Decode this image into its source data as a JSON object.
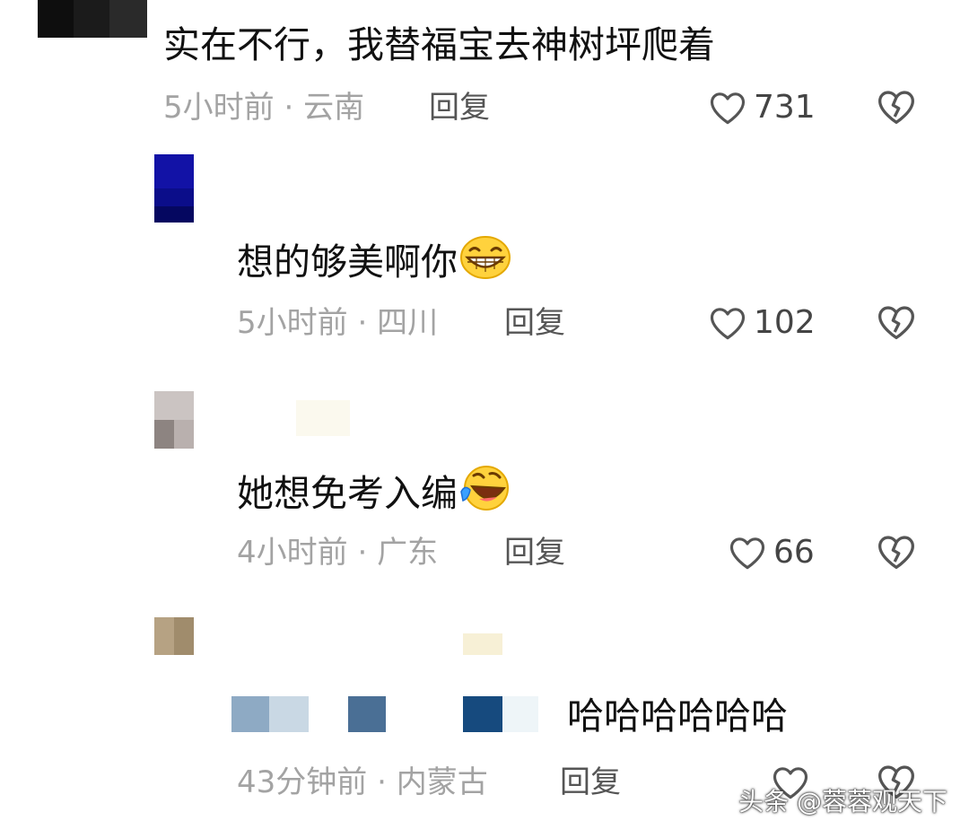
{
  "comments": [
    {
      "text": "实在不行，我替福宝去神树坪爬着",
      "time": "5小时前",
      "location": "云南",
      "reply_label": "回复",
      "likes": "731"
    },
    {
      "text": "想的够美啊你",
      "emoji": "grinning-face-emoji",
      "time": "5小时前",
      "location": "四川",
      "reply_label": "回复",
      "likes": "102"
    },
    {
      "text": "她想免考入编",
      "emoji": "rolling-laughing-emoji",
      "time": "4小时前",
      "location": "广东",
      "reply_label": "回复",
      "likes": "66"
    },
    {
      "text": "哈哈哈哈哈哈",
      "time": "43分钟前",
      "location": "内蒙古",
      "reply_label": "回复",
      "likes": ""
    }
  ],
  "separator": "·",
  "watermark": "头条 @蓉蓉观天下",
  "colors": {
    "text": "#111111",
    "meta": "#a3a3a3",
    "icon": "#555555"
  }
}
